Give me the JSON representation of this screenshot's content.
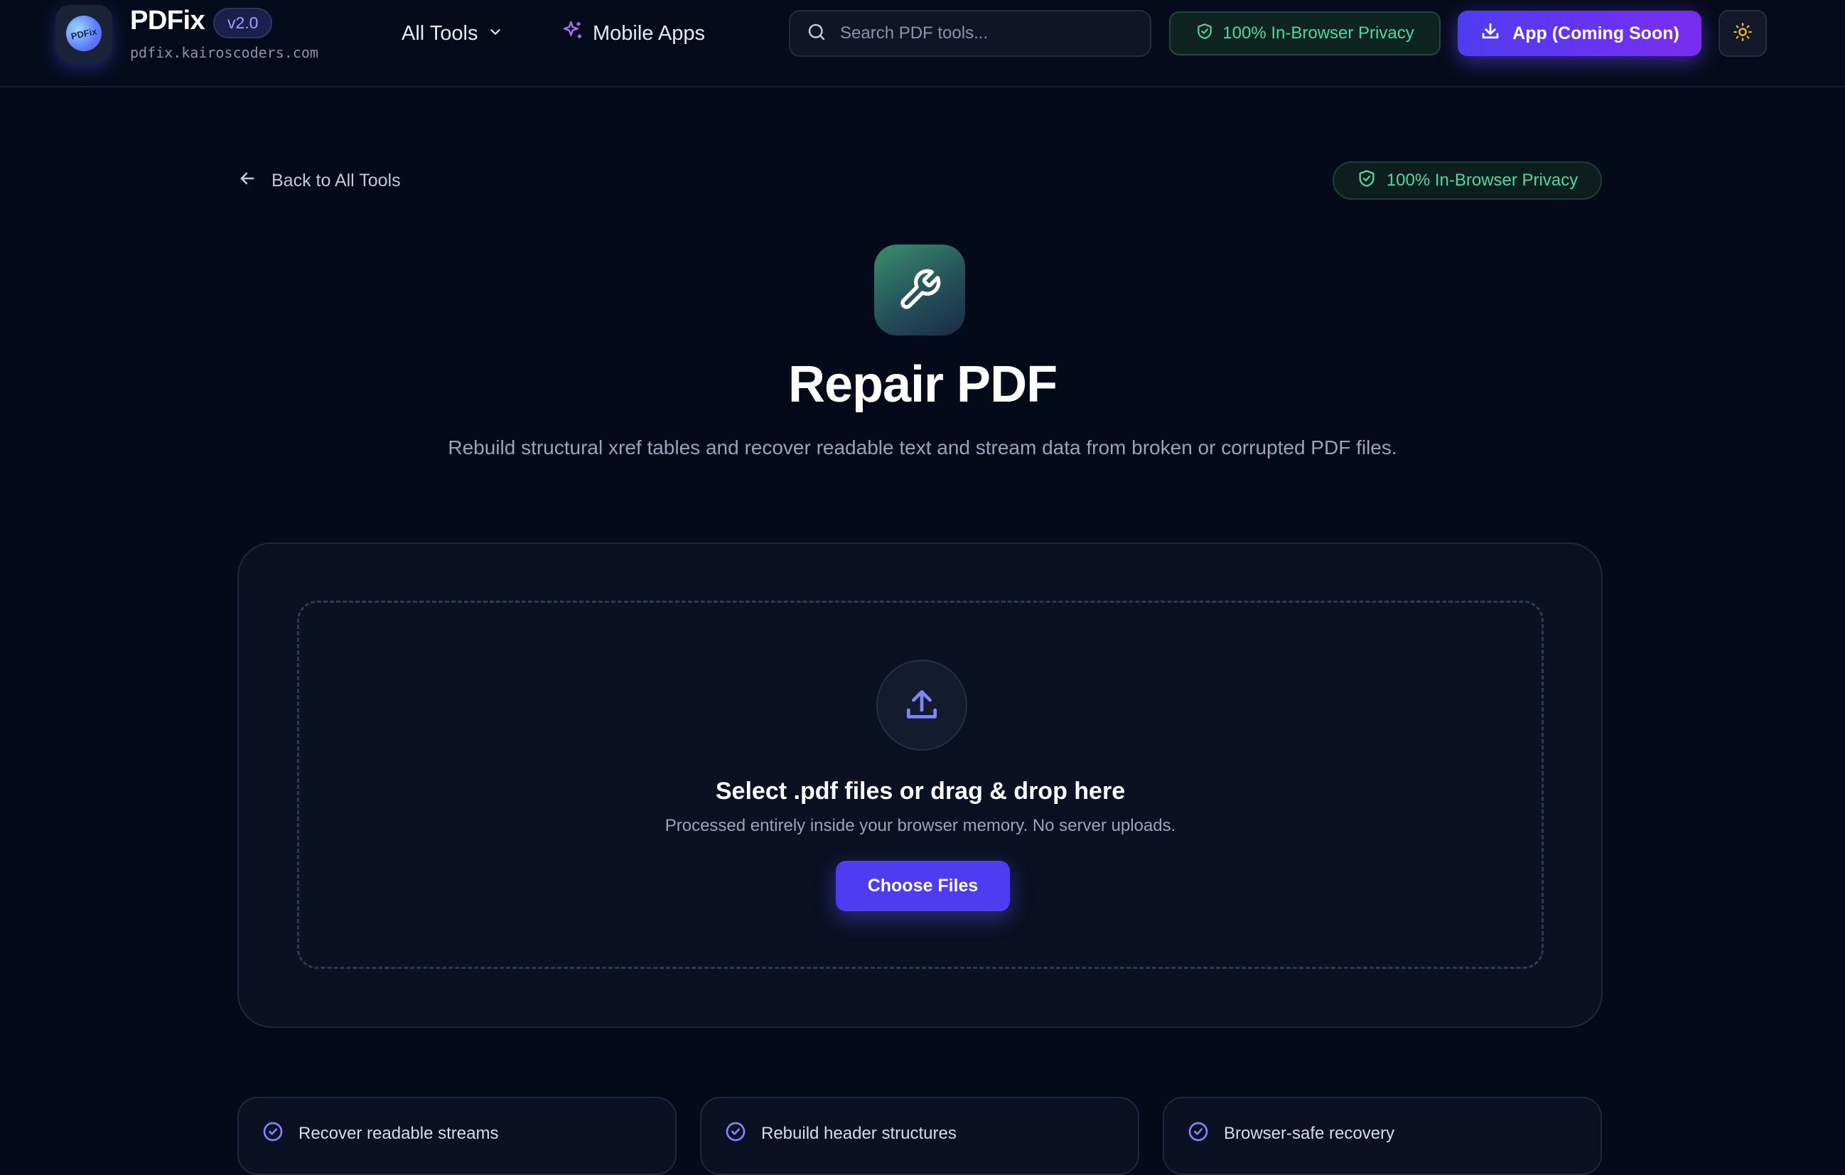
{
  "header": {
    "logo_text": "PDFix",
    "brand_name": "PDFix",
    "version": "v2.0",
    "url": "pdfix.kairoscoders.com",
    "nav": {
      "all_tools": "All Tools",
      "mobile_apps": "Mobile Apps"
    },
    "search_placeholder": "Search PDF tools...",
    "privacy_badge": "100% In-Browser Privacy",
    "app_button": "App (Coming Soon)",
    "icons": {
      "logo": "pdfix-logo-icon",
      "dropdown": "chevron-down-icon",
      "mobile": "sparkles-icon",
      "search": "search-icon",
      "privacy": "shield-check-icon",
      "app": "download-icon",
      "theme": "sun-icon"
    }
  },
  "main": {
    "back_link": "Back to All Tools",
    "privacy_badge": "100% In-Browser Privacy",
    "tool_icon": "wrench-icon",
    "title": "Repair PDF",
    "description": "Rebuild structural xref tables and recover readable text and stream data from broken or corrupted PDF files.",
    "upload": {
      "icon": "upload-icon",
      "title": "Select .pdf files or drag & drop here",
      "subtitle": "Processed entirely inside your browser memory. No server uploads.",
      "button": "Choose Files"
    },
    "features": [
      {
        "label": "Recover readable streams",
        "icon": "check-circle-icon"
      },
      {
        "label": "Rebuild header structures",
        "icon": "check-circle-icon"
      },
      {
        "label": "Browser-safe recovery",
        "icon": "check-circle-icon"
      }
    ]
  },
  "colors": {
    "background": "#050a1a",
    "accent": "#4f3cf0",
    "accent_purple": "#7a2cf0",
    "privacy_green": "#4fd8a0",
    "sun_yellow": "#f5b82e",
    "check_purple": "#7f86ff"
  }
}
